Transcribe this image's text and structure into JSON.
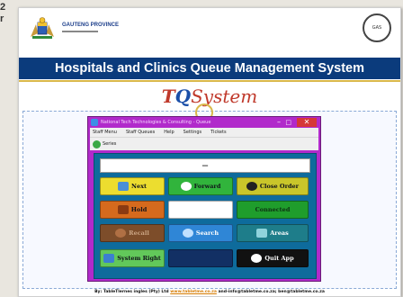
{
  "side_text": [
    "2",
    "r"
  ],
  "header": {
    "province_name": "GAUTENG PROVINCE",
    "seal_text": "GAS"
  },
  "title": "Hospitals and Clinics Queue Management System",
  "logo": {
    "t": "T",
    "q": "Q",
    "s": "System"
  },
  "window": {
    "title": "National Tech Technologies & Consulting - Queue",
    "controls": {
      "minimize": "–",
      "maximize": "□",
      "close": "✕"
    },
    "menu": [
      "Staff Menu",
      "Staff Queues",
      "Help",
      "Settings",
      "Tickets"
    ],
    "toolbar_button": "Series",
    "display_value": "—",
    "buttons": {
      "next": "Next",
      "forward": "Forward",
      "close_order": "Close Order",
      "hold": "Hold",
      "connected": "Connected",
      "recall": "Recall",
      "search": "Search",
      "areas": "Areas",
      "system_right": "System Right",
      "quit": "Quit App"
    }
  },
  "footer": {
    "prefix": "By: TableTlernes ingles (Pty) Ltd",
    "link": "www.tabletme.co.za",
    "suffix": "and-info@tabletme.co.za; ben@tabletme.co.za"
  },
  "colors": {
    "title_bar": "#0b3b7c",
    "window_frame": "#b12acb",
    "client_area": "#0e6b9c"
  }
}
